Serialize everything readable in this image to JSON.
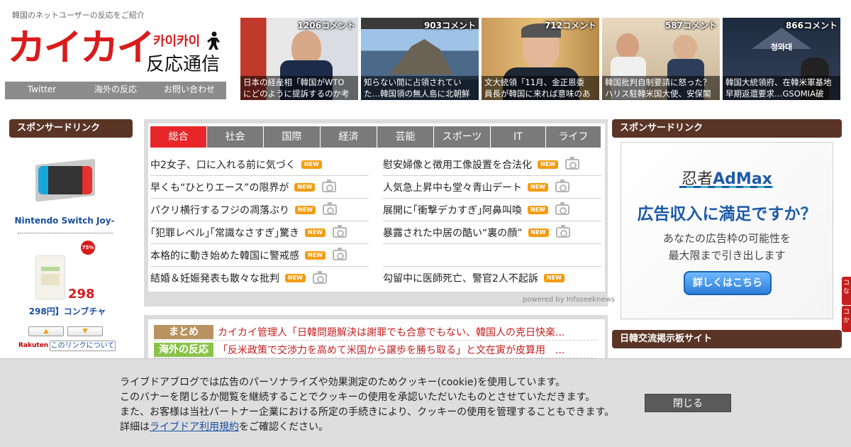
{
  "site": {
    "tagline": "韓国のネットユーザーの反応をご紹介",
    "logo_main": "カイカイ",
    "logo_kana": "카이카이",
    "logo_sub": "反応通信"
  },
  "topnav": [
    "Twitter",
    "海外の反応",
    "お問い合わせ"
  ],
  "thumbnails": [
    {
      "count": "1206コメント",
      "line1": "日本の経産相「韓国がWTO",
      "line2": "にどのように提訴するのか考"
    },
    {
      "count": "903コメント",
      "line1": "知らない間に占領されてい",
      "line2": "た…韓国領の無人島に北朝鮮"
    },
    {
      "count": "712コメント",
      "line1": "文大統領「11月、金正恩委",
      "line2": "員長が韓国に来れば意味のあ"
    },
    {
      "count": "587コメント",
      "line1": "韓国批判自制要請に怒った？",
      "line2": "ハリス駐韓米国大使、安保閣"
    },
    {
      "count": "866コメント",
      "line1": "韓国大統領府、在韓米軍基地",
      "line2": "早期返還要求…GSOMIA破"
    }
  ],
  "left_sidebar": {
    "header": "スポンサードリンク",
    "product1_name": "Nintendo Switch Joy-",
    "product2_badge": "75%",
    "product2_price": "298",
    "product2_name": "298円】コンブチャ",
    "rakuten": "Rakuten",
    "about_link": "このリンクについて"
  },
  "news": {
    "tabs": [
      "総合",
      "社会",
      "国際",
      "経済",
      "芸能",
      "スポーツ",
      "IT",
      "ライフ"
    ],
    "active_tab": "総合",
    "left": [
      {
        "title": "中2女子、口に入れる前に気づく",
        "new": "NEW",
        "photo": false
      },
      {
        "title": "早くも“ひとりエース”の限界が",
        "new": "NEW",
        "photo": true
      },
      {
        "title": "パクリ横行するフジの凋落ぶり",
        "new": "NEW",
        "photo": true
      },
      {
        "title": "｢犯罪レベル｣｢常識なさすぎ｣驚き",
        "new": "NEW",
        "photo": true
      },
      {
        "title": "本格的に動き始めた韓国に警戒感",
        "new": "NEW",
        "photo": true
      },
      {
        "title": "結婚＆妊娠発表も散々な批判",
        "new": "NEW",
        "photo": true
      }
    ],
    "right": [
      {
        "title": "慰安婦像と徴用工像設置を合法化",
        "new": "NEW",
        "photo": true
      },
      {
        "title": "人気急上昇中も堂々青山デート",
        "new": "NEW",
        "photo": true
      },
      {
        "title": "展開に｢衝撃デカすぎ｣阿鼻叫喚",
        "new": "NEW",
        "photo": true
      },
      {
        "title": "暴露された中居の酷い“裏の顔”",
        "new": "NEW",
        "photo": true
      },
      {
        "title": "",
        "new": "",
        "photo": false
      },
      {
        "title": "勾留中に医師死亡、警官2人不起訴",
        "new": "NEW",
        "photo": false
      }
    ],
    "powered_by": "powered by Infoseeknews"
  },
  "matome": [
    {
      "tag": "まとめ",
      "tag_color": "#b8935f",
      "text": "カイカイ管理人「日韓問題解決は謝罪でも合意でもない、韓国人の克日快楽..."
    },
    {
      "tag": "海外の反応",
      "tag_color": "#8bc34a",
      "text": "「反米政策で交渉力を高めて米国から譲歩を勝ち取る」と文在寅が皮算用　..."
    }
  ],
  "right_sidebar": {
    "header": "スポンサードリンク",
    "ad_brand_prefix": "忍者",
    "ad_brand_name": "AdMax",
    "ad_headline": "広告収入に満足ですか？",
    "ad_body1": "あなたの広告枠の可能性を",
    "ad_body2": "最大限まで引き出します",
    "ad_button": "詳しくはこちら",
    "header2": "日韓交流掲示板サイト",
    "edge_tab1": "コな",
    "edge_tab2": "コか"
  },
  "cookie": {
    "line1": "ライブドアブログでは広告のパーソナライズや効果測定のためクッキー(cookie)を使用しています。",
    "line2": "このバナーを閉じるか閲覧を継続することでクッキーの使用を承認いただいたものとさせていただきます。",
    "line3": "また、お客様は当社パートナー企業における所定の手続きにより、クッキーの使用を管理することもできます。",
    "line4_prefix": "詳細は",
    "line4_link": "ライブドア利用規約",
    "line4_suffix": "をご確認ください。",
    "close_button": "閉じる"
  },
  "colors": {
    "brand_red": "#d81c1c",
    "sidebar_header": "#5a3526",
    "tab_active": "#e8262a",
    "tab_inactive": "#7a7a7a",
    "new_badge": "#f39c12"
  }
}
